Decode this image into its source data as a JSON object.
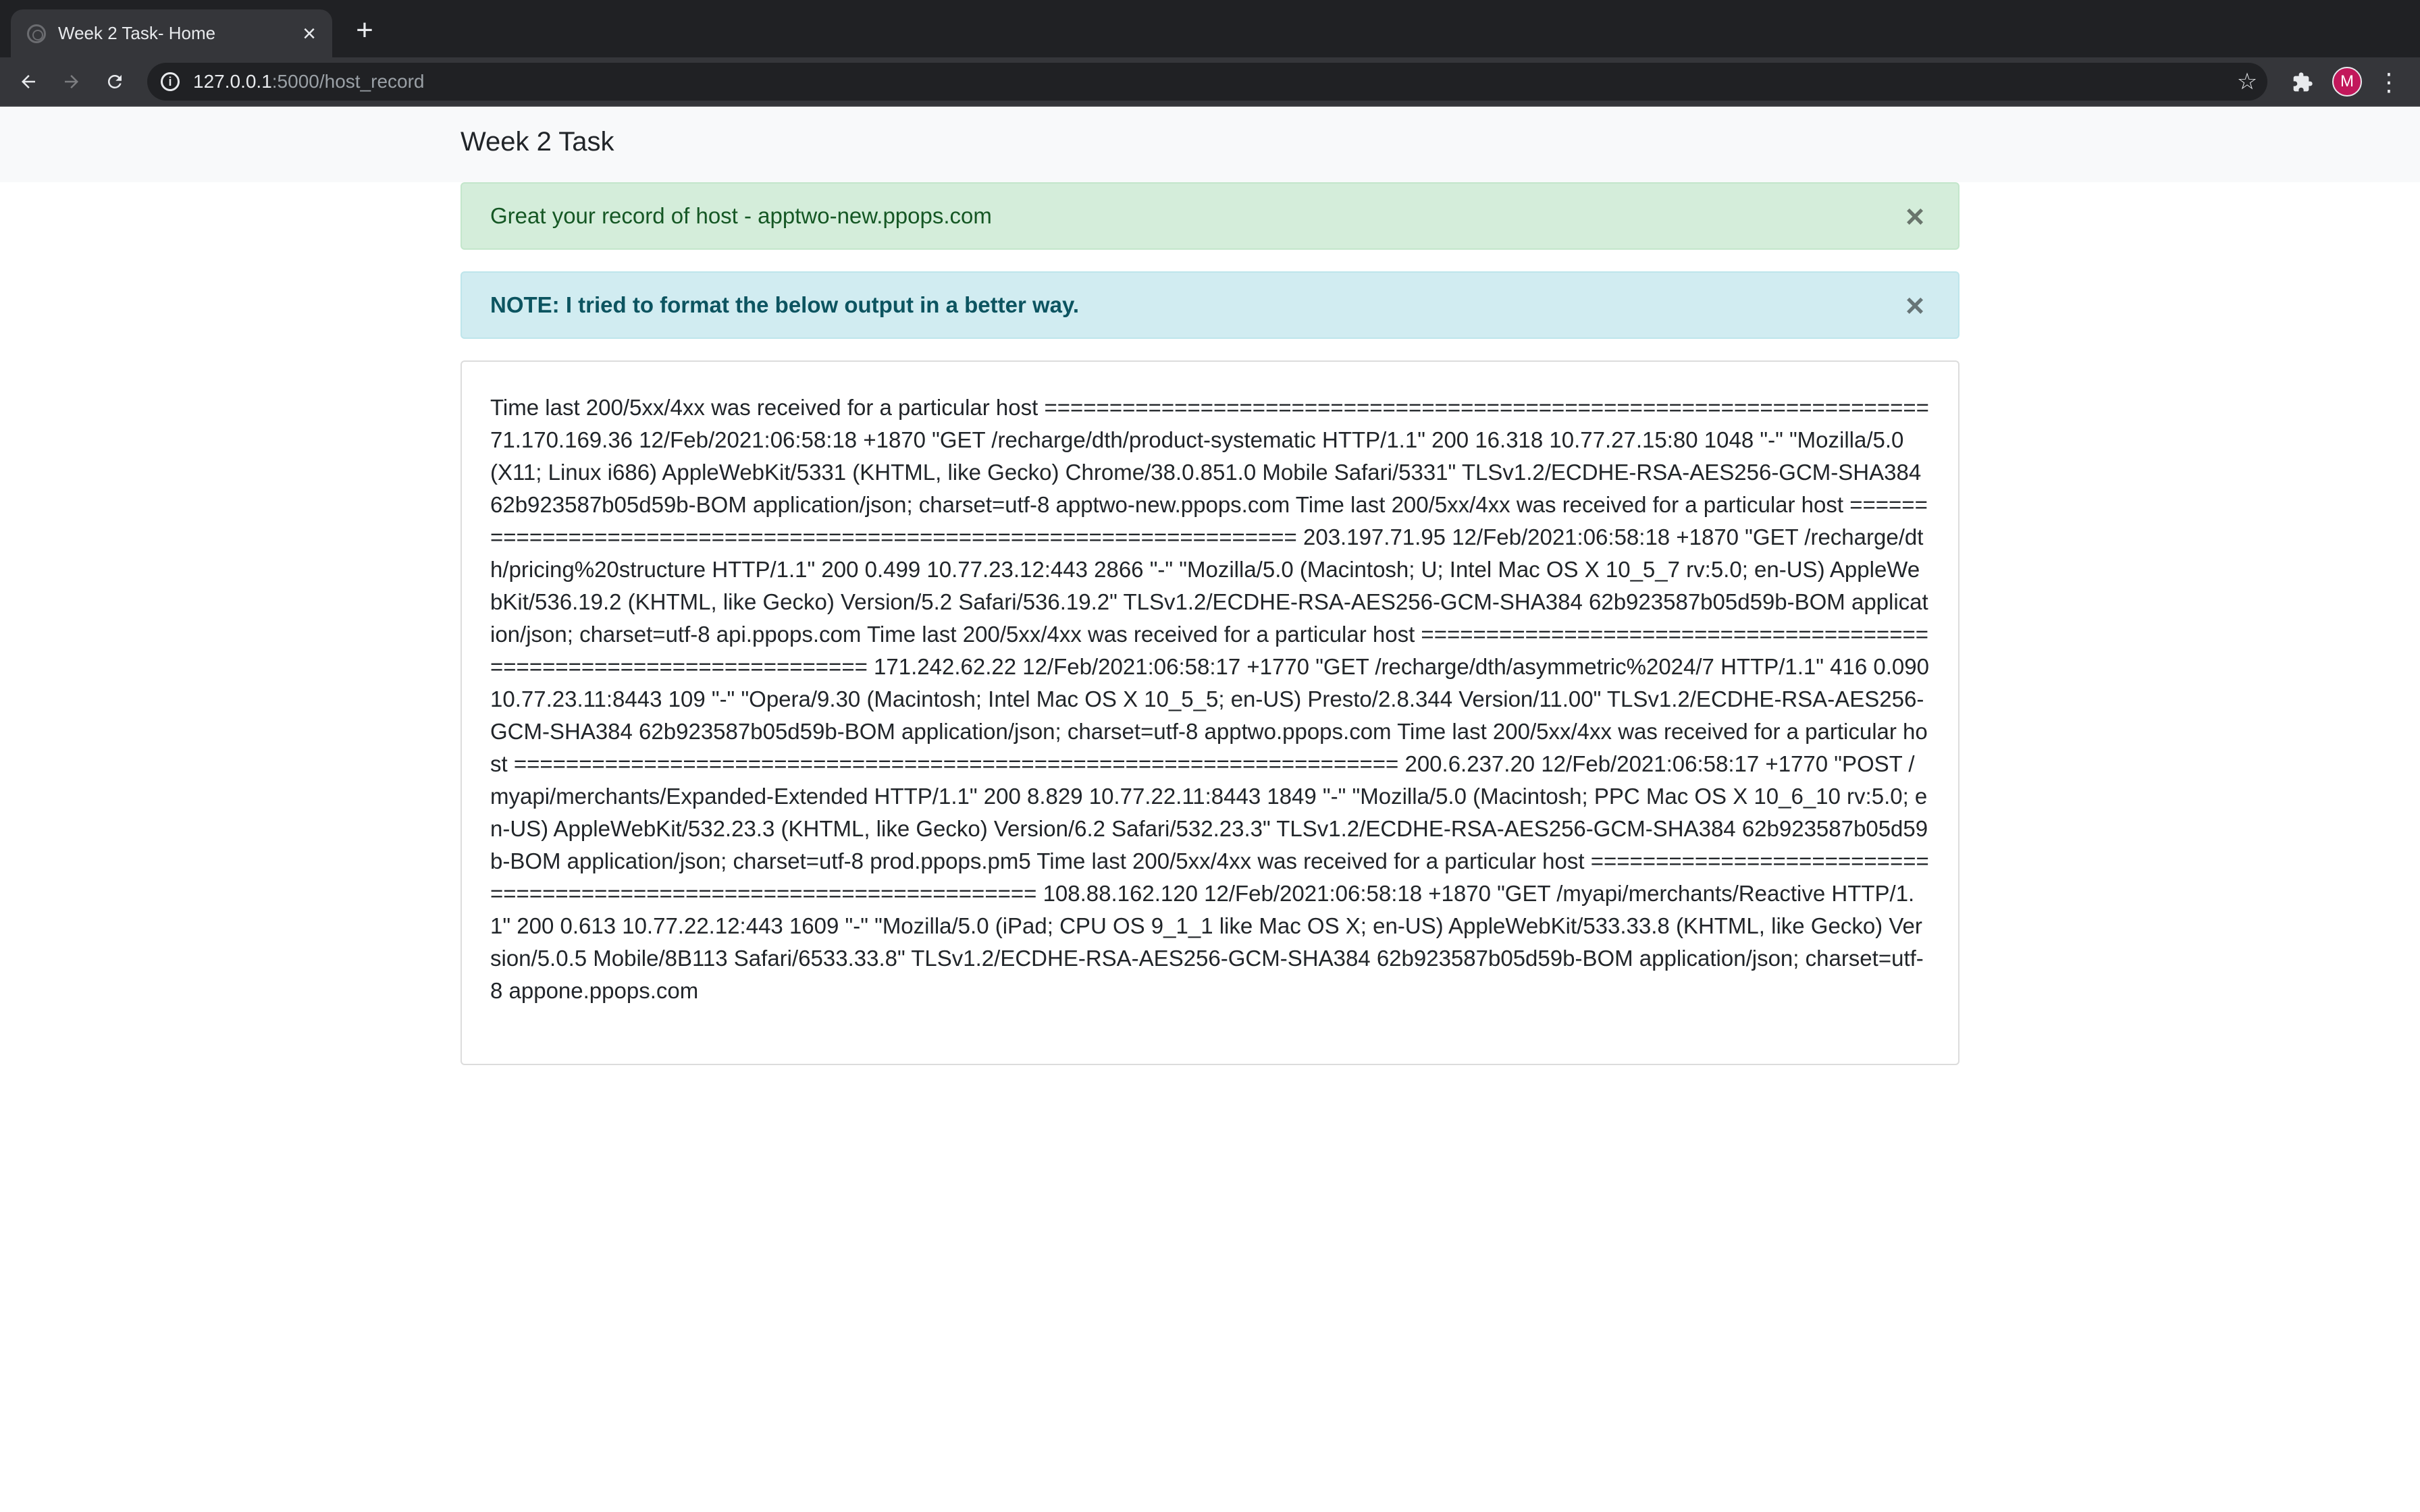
{
  "browser": {
    "tab_title": "Week 2 Task- Home",
    "url_host": "127.0.0.1",
    "url_rest": ":5000/host_record",
    "profile_initial": "M"
  },
  "page": {
    "brand": "Week 2 Task",
    "alerts": {
      "success": "Great your record of host - apptwo-new.ppops.com",
      "info": "NOTE: I tried to format the below output in a better way."
    },
    "record_text": "Time last 200/5xx/4xx was received for a particular host ==================================================================== 71.170.169.36 12/Feb/2021:06:58:18 +1870 \"GET /recharge/dth/product-systematic HTTP/1.1\" 200 16.318 10.77.27.15:80 1048 \"-\" \"Mozilla/5.0 (X11; Linux i686) AppleWebKit/5331 (KHTML, like Gecko) Chrome/38.0.851.0 Mobile Safari/5331\" TLSv1.2/ECDHE-RSA-AES256-GCM-SHA384 62b923587b05d59b-BOM application/json; charset=utf-8 apptwo-new.ppops.com Time last 200/5xx/4xx was received for a particular host ==================================================================== 203.197.71.95 12/Feb/2021:06:58:18 +1870 \"GET /recharge/dth/pricing%20structure HTTP/1.1\" 200 0.499 10.77.23.12:443 2866 \"-\" \"Mozilla/5.0 (Macintosh; U; Intel Mac OS X 10_5_7 rv:5.0; en-US) AppleWebKit/536.19.2 (KHTML, like Gecko) Version/5.2 Safari/536.19.2\" TLSv1.2/ECDHE-RSA-AES256-GCM-SHA384 62b923587b05d59b-BOM application/json; charset=utf-8 api.ppops.com Time last 200/5xx/4xx was received for a particular host ==================================================================== 171.242.62.22 12/Feb/2021:06:58:17 +1770 \"GET /recharge/dth/asymmetric%2024/7 HTTP/1.1\" 416 0.090 10.77.23.11:8443 109 \"-\" \"Opera/9.30 (Macintosh; Intel Mac OS X 10_5_5; en-US) Presto/2.8.344 Version/11.00\" TLSv1.2/ECDHE-RSA-AES256-GCM-SHA384 62b923587b05d59b-BOM application/json; charset=utf-8 apptwo.ppops.com Time last 200/5xx/4xx was received for a particular host ==================================================================== 200.6.237.20 12/Feb/2021:06:58:17 +1770 \"POST /myapi/merchants/Expanded-Extended HTTP/1.1\" 200 8.829 10.77.22.11:8443 1849 \"-\" \"Mozilla/5.0 (Macintosh; PPC Mac OS X 10_6_10 rv:5.0; en-US) AppleWebKit/532.23.3 (KHTML, like Gecko) Version/6.2 Safari/532.23.3\" TLSv1.2/ECDHE-RSA-AES256-GCM-SHA384 62b923587b05d59b-BOM application/json; charset=utf-8 prod.ppops.pm5 Time last 200/5xx/4xx was received for a particular host ==================================================================== 108.88.162.120 12/Feb/2021:06:58:18 +1870 \"GET /myapi/merchants/Reactive HTTP/1.1\" 200 0.613 10.77.22.12:443 1609 \"-\" \"Mozilla/5.0 (iPad; CPU OS 9_1_1 like Mac OS X; en-US) AppleWebKit/533.33.8 (KHTML, like Gecko) Version/5.0.5 Mobile/8B113 Safari/6533.33.8\" TLSv1.2/ECDHE-RSA-AES256-GCM-SHA384 62b923587b05d59b-BOM application/json; charset=utf-8 appone.ppops.com"
  },
  "icons": {
    "tab_favicon": "globe-icon",
    "tab_close": "close-icon",
    "new_tab": "plus-icon",
    "back": "arrow-left-icon",
    "forward": "arrow-right-icon",
    "reload": "reload-icon",
    "site_info": "info-icon",
    "bookmark": "star-icon",
    "extensions": "puzzle-icon",
    "menu": "kebab-menu-icon",
    "alert_close": "close-icon"
  },
  "colors": {
    "success_bg": "#d4edda",
    "success_text": "#155724",
    "info_bg": "#d1ecf1",
    "info_text": "#0c5460",
    "avatar": "#c2185b"
  }
}
